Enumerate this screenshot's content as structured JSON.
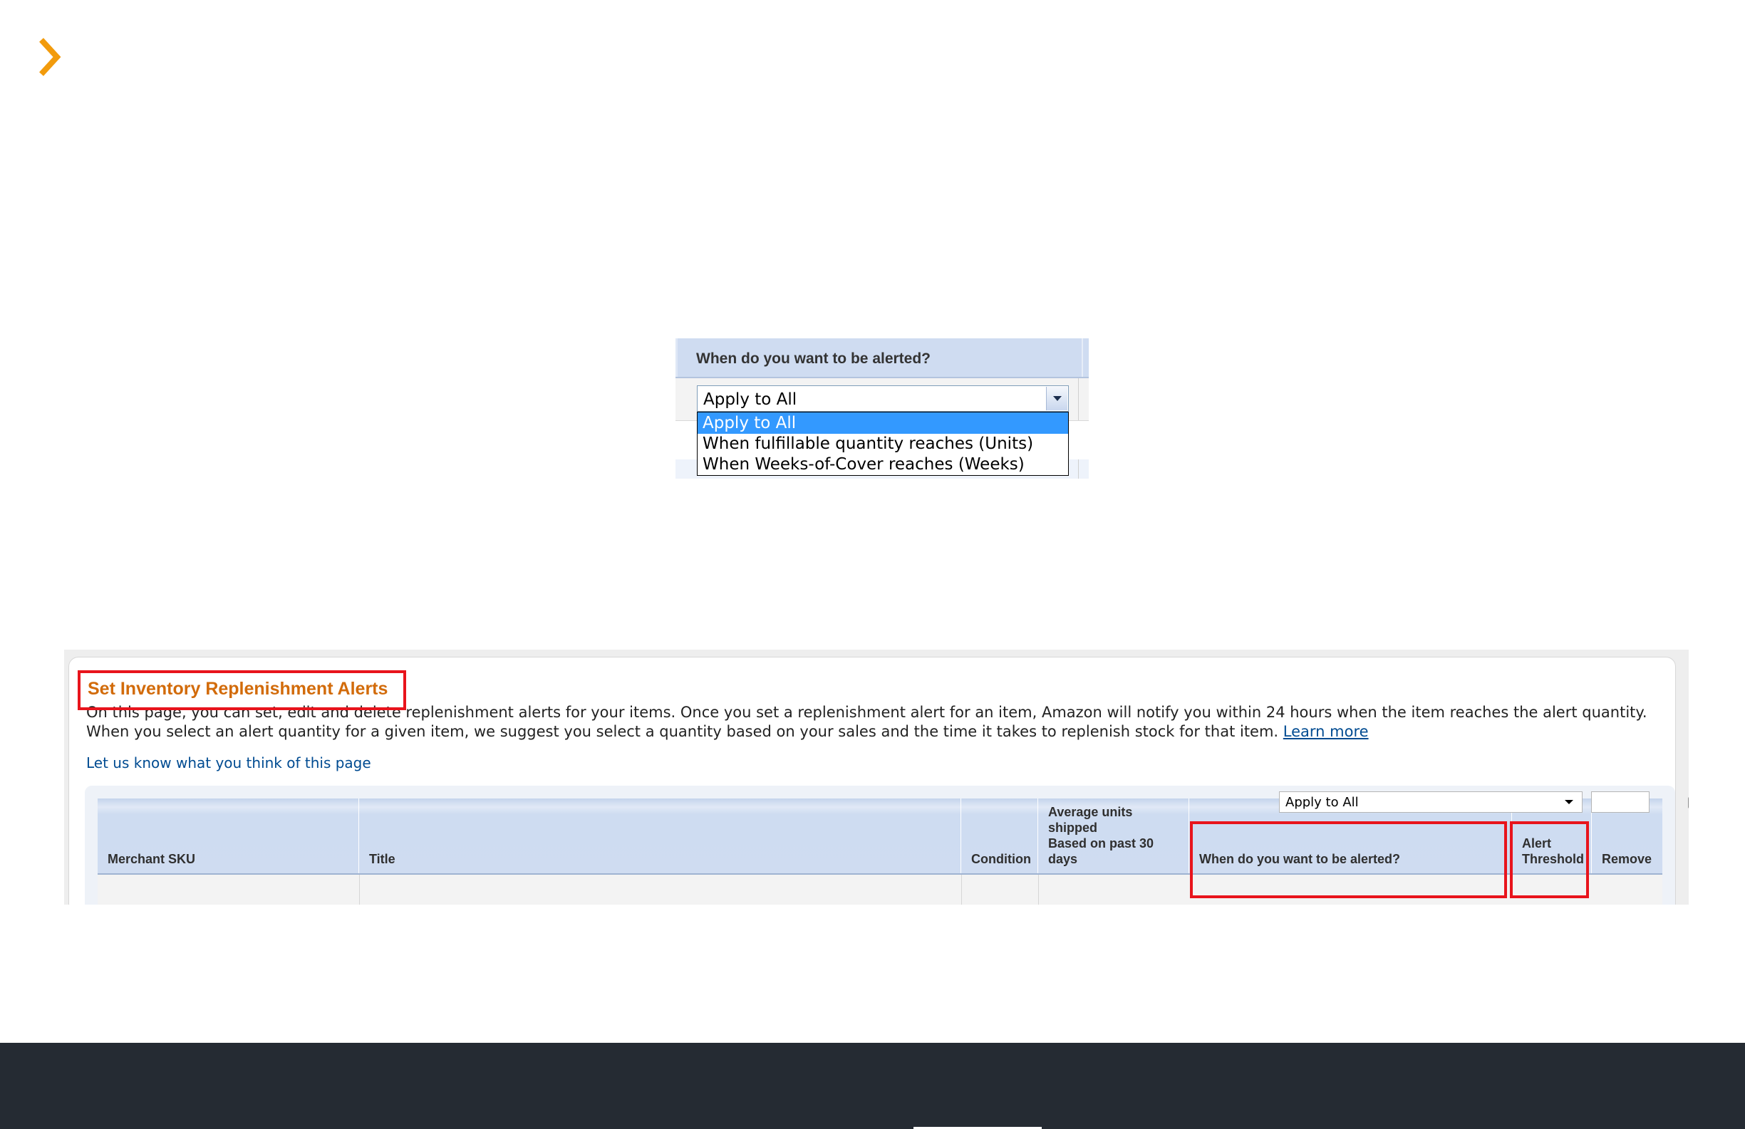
{
  "colors": {
    "accent_orange": "#f29b0c",
    "heading_orange": "#d26b0a",
    "highlight_red": "#e8141c",
    "link_blue": "#004b91",
    "selected_option": "#3399ff",
    "footer": "#252b33"
  },
  "icons": {
    "nav": "chevron-right-icon",
    "dropdown": "chevron-down-icon"
  },
  "zoom": {
    "column_header": "When do you want to be alerted?",
    "select_value": "Apply to All",
    "options": [
      "Apply to All",
      "When fulfillable quantity reaches (Units)",
      "When Weeks-of-Cover reaches (Weeks)"
    ]
  },
  "page": {
    "heading": "Set Inventory Replenishment Alerts",
    "description_line1": "On this page, you can set, edit and delete replenishment alerts for your items. Once you set a replenishment alert for an item, Amazon will notify you within 24 hours when the item reaches the alert quantity.",
    "description_line2": "When you select an alert quantity for a given item, we suggest you select a quantity based on your sales and the time it takes to replenish stock for that item.",
    "learn_more": "Learn more",
    "feedback_link": "Let us know what you think of this page"
  },
  "table": {
    "headers": {
      "merchant_sku": "Merchant SKU",
      "title": "Title",
      "condition": "Condition",
      "avg_units_line1": "Average units",
      "avg_units_line2": "shipped",
      "avg_units_line3": "Based on past 30",
      "avg_units_line4": "days",
      "alert_when": "When do you want to be alerted?",
      "threshold_line1": "Alert",
      "threshold_line2": "Threshold",
      "remove": "Remove"
    },
    "apply_all_row": {
      "select_value": "Apply to All",
      "threshold_value": "",
      "remove_checked": false
    }
  }
}
